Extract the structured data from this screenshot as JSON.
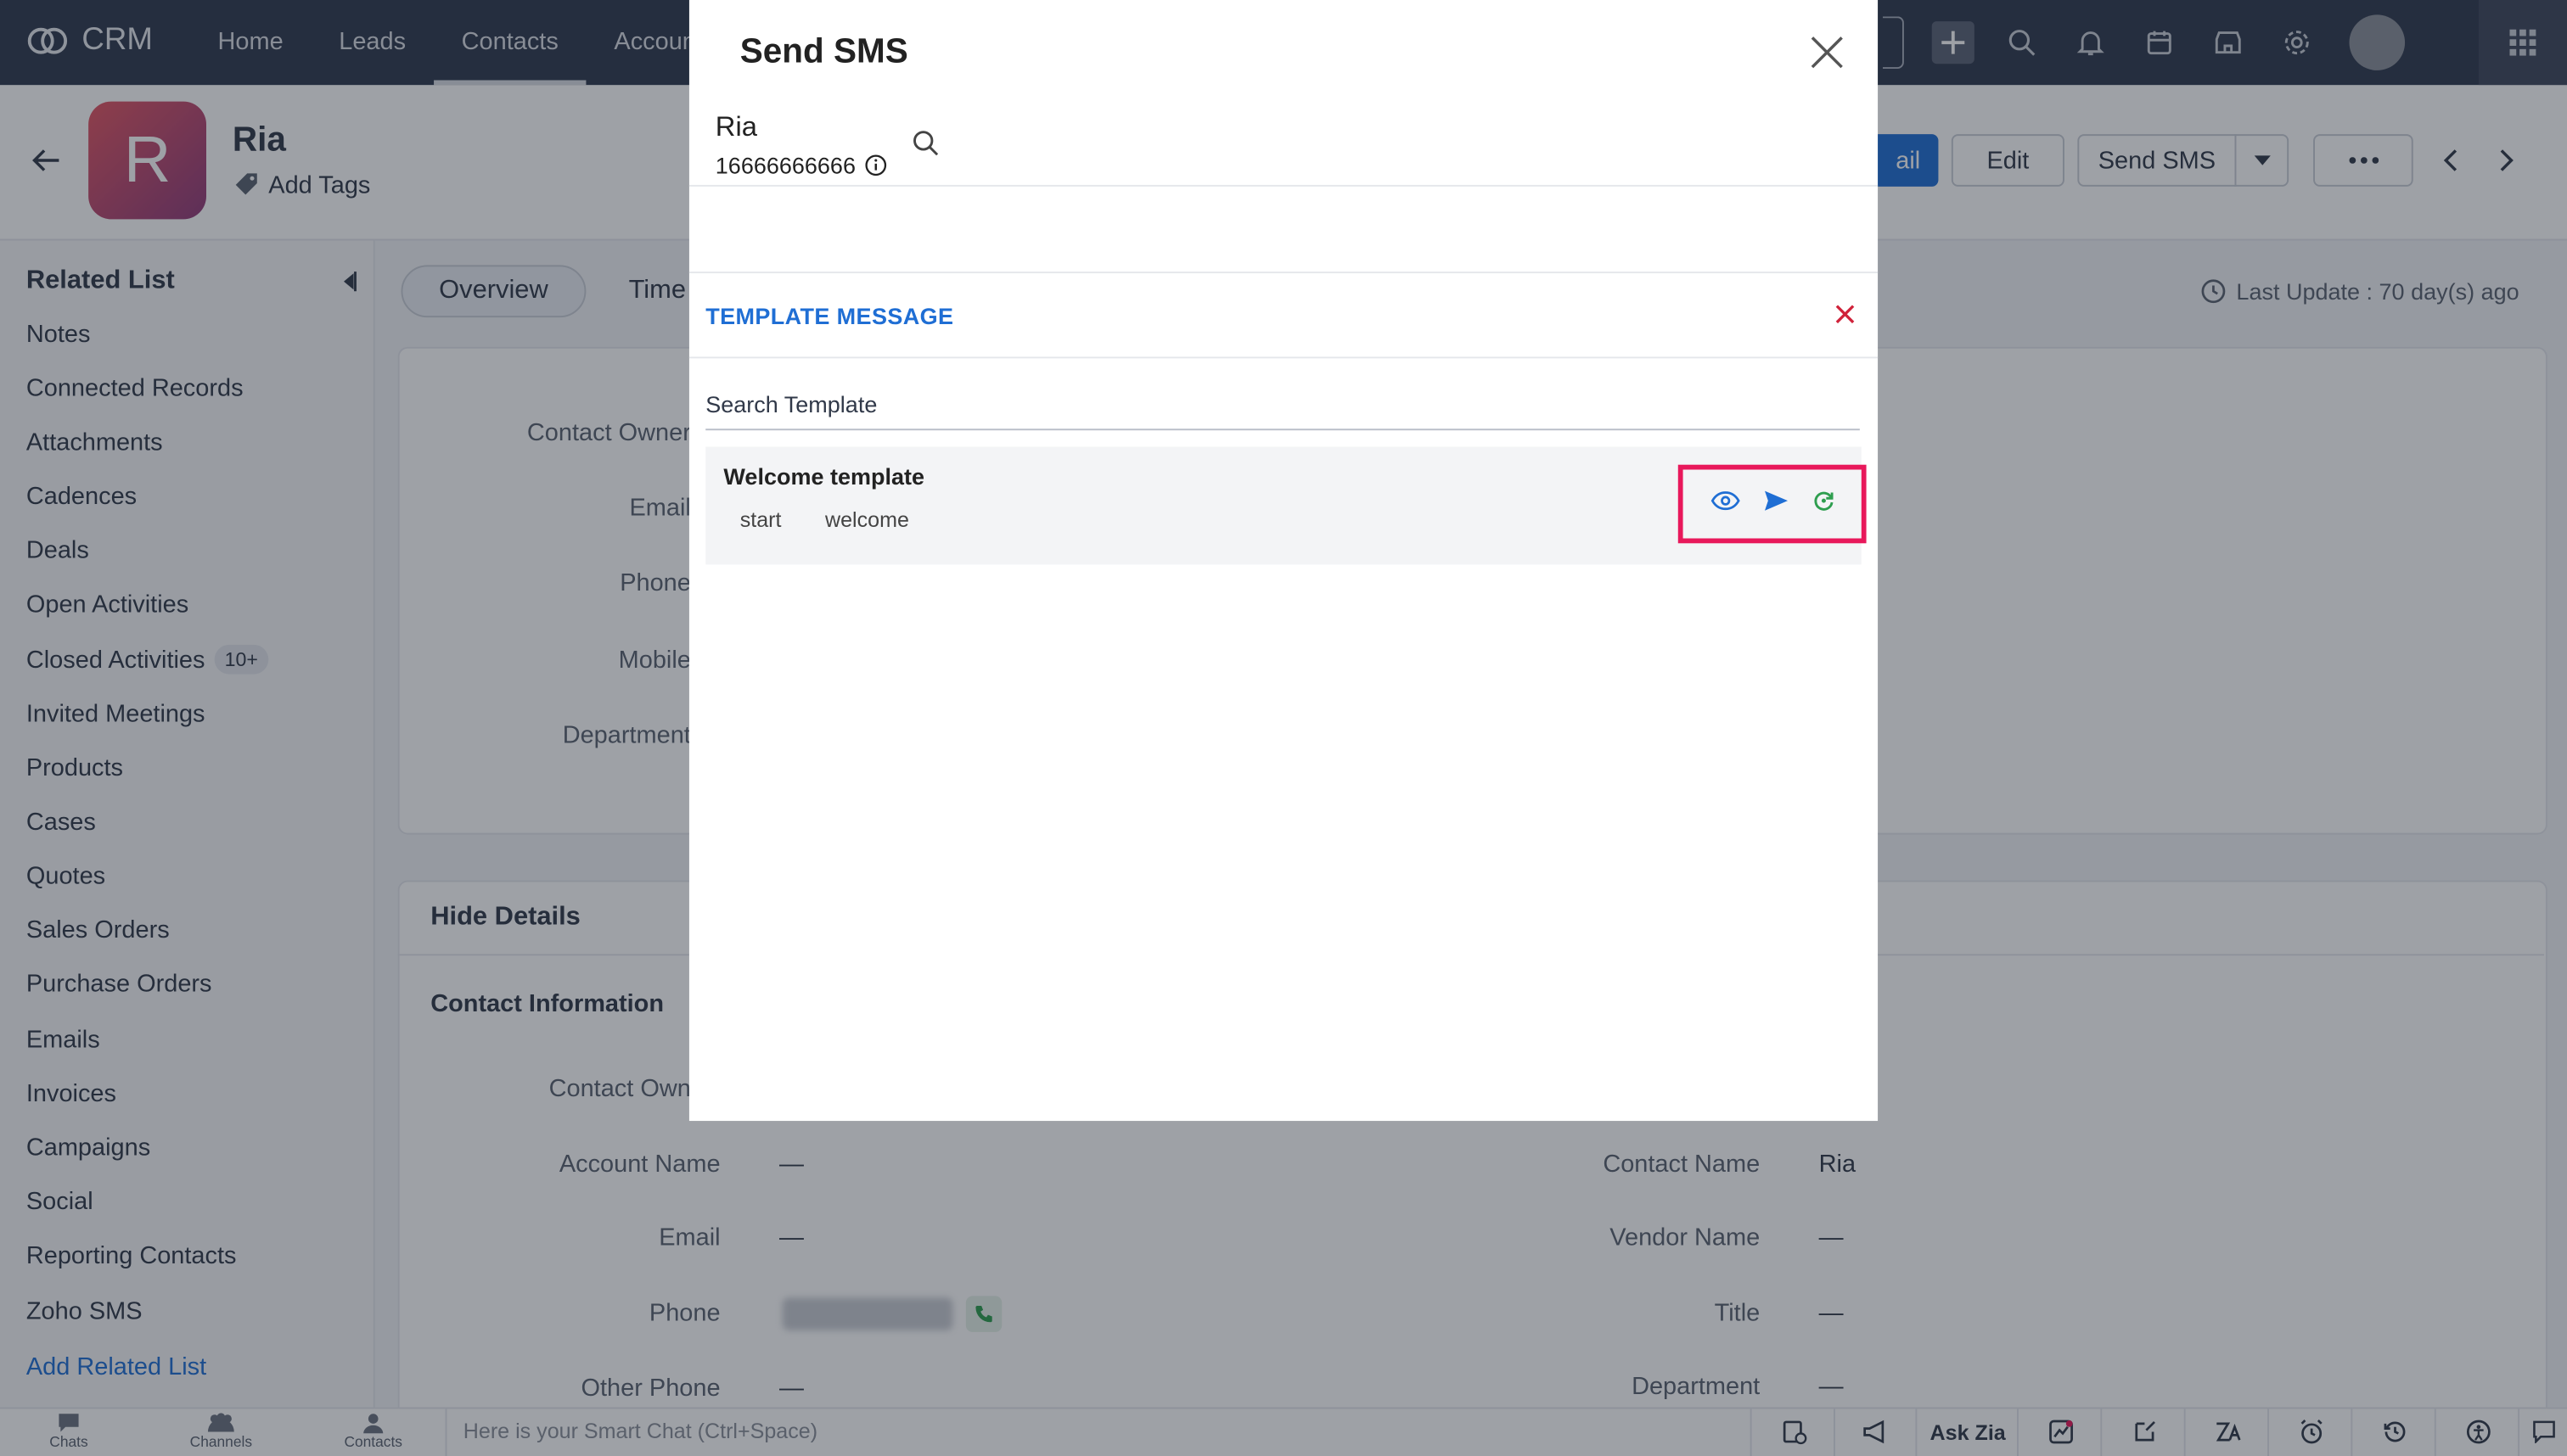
{
  "app": {
    "name": "CRM"
  },
  "nav": {
    "tabs": [
      "Home",
      "Leads",
      "Contacts",
      "Accounts"
    ],
    "active": "Contacts"
  },
  "record": {
    "avatar_letter": "R",
    "name": "Ria",
    "add_tags": "Add Tags",
    "buttons": {
      "email_partial": "ail",
      "edit": "Edit",
      "send_sms": "Send SMS"
    }
  },
  "sidebar": {
    "title": "Related List",
    "items": [
      "Notes",
      "Connected Records",
      "Attachments",
      "Cadences",
      "Deals",
      "Open Activities",
      "Closed Activities",
      "Invited Meetings",
      "Products",
      "Cases",
      "Quotes",
      "Sales Orders",
      "Purchase Orders",
      "Emails",
      "Invoices",
      "Campaigns",
      "Social",
      "Reporting Contacts",
      "Zoho SMS"
    ],
    "closed_activities_badge": "10+",
    "add_related": "Add Related List"
  },
  "main": {
    "tabs": {
      "overview": "Overview",
      "timeline_partial": "Time"
    },
    "last_update": "Last Update : 70 day(s) ago",
    "summary_labels": [
      "Contact Owner",
      "Email",
      "Phone",
      "Mobile",
      "Department"
    ],
    "hide_details": "Hide Details",
    "contact_info_title": "Contact Information",
    "left_fields": [
      {
        "label": "Contact Own",
        "value": ""
      },
      {
        "label": "Account Name",
        "value": "—"
      },
      {
        "label": "Email",
        "value": "—"
      },
      {
        "label": "Phone",
        "value": ""
      },
      {
        "label": "Other Phone",
        "value": "—"
      }
    ],
    "right_fields": [
      {
        "label": "Contact Name",
        "value": "Ria"
      },
      {
        "label": "Vendor Name",
        "value": "—"
      },
      {
        "label": "Title",
        "value": "—"
      },
      {
        "label": "Department",
        "value": "—"
      }
    ]
  },
  "modal": {
    "title": "Send SMS",
    "recipient_name": "Ria",
    "recipient_phone": "16666666666",
    "template_section_label": "TEMPLATE MESSAGE",
    "search_placeholder": "Search Template",
    "templates": [
      {
        "name": "Welcome template",
        "tags": [
          "start",
          "welcome"
        ]
      }
    ]
  },
  "bottom": {
    "chats": "Chats",
    "channels": "Channels",
    "contacts": "Contacts",
    "smart_chat_placeholder": "Here is your Smart Chat (Ctrl+Space)",
    "ask_zia": "Ask Zia"
  },
  "colors": {
    "accent": "#1f6ed4",
    "highlight": "#e8185b",
    "topbar": "#30394e"
  }
}
